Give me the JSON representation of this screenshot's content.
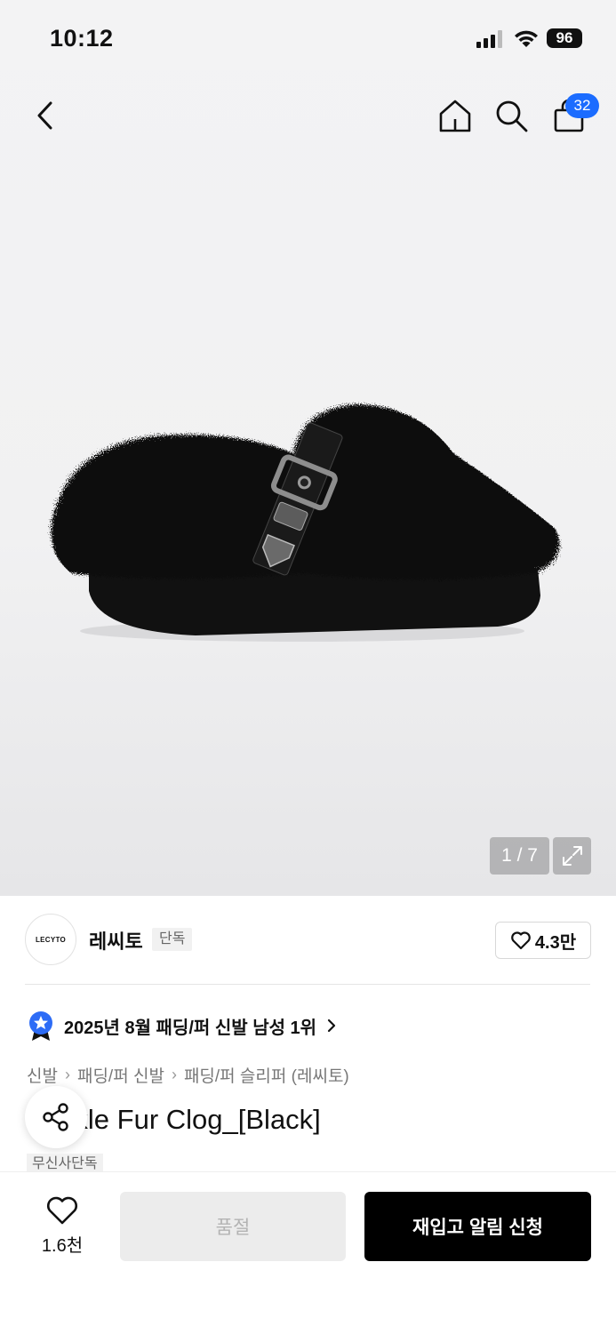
{
  "status_bar": {
    "time": "10:12",
    "battery": "96"
  },
  "header": {
    "cart_count": "32",
    "icons": [
      "back-icon",
      "home-icon",
      "search-icon",
      "cart-icon"
    ]
  },
  "gallery": {
    "counter": "1 / 7",
    "current": 1,
    "total": 7
  },
  "brand": {
    "logo_text": "LECYTO",
    "name": "레씨토",
    "tag": "단독",
    "likes": "4.3만"
  },
  "ranking": {
    "text": "2025년 8월 패딩/퍼 신발 남성 1위"
  },
  "breadcrumb": {
    "items": [
      "신발",
      "패딩/퍼 신발",
      "패딩/퍼 슬리퍼 (레씨토)"
    ]
  },
  "product": {
    "title": "Buckle Fur Clog_[Black]",
    "badge": "무신사단독"
  },
  "bottom_bar": {
    "wish_count": "1.6천",
    "soldout_label": "품절",
    "restock_label": "재입고 알림 신청"
  },
  "colors": {
    "accent": "#1b6cff",
    "primary_button": "#000000",
    "disabled_button": "#ececec"
  }
}
